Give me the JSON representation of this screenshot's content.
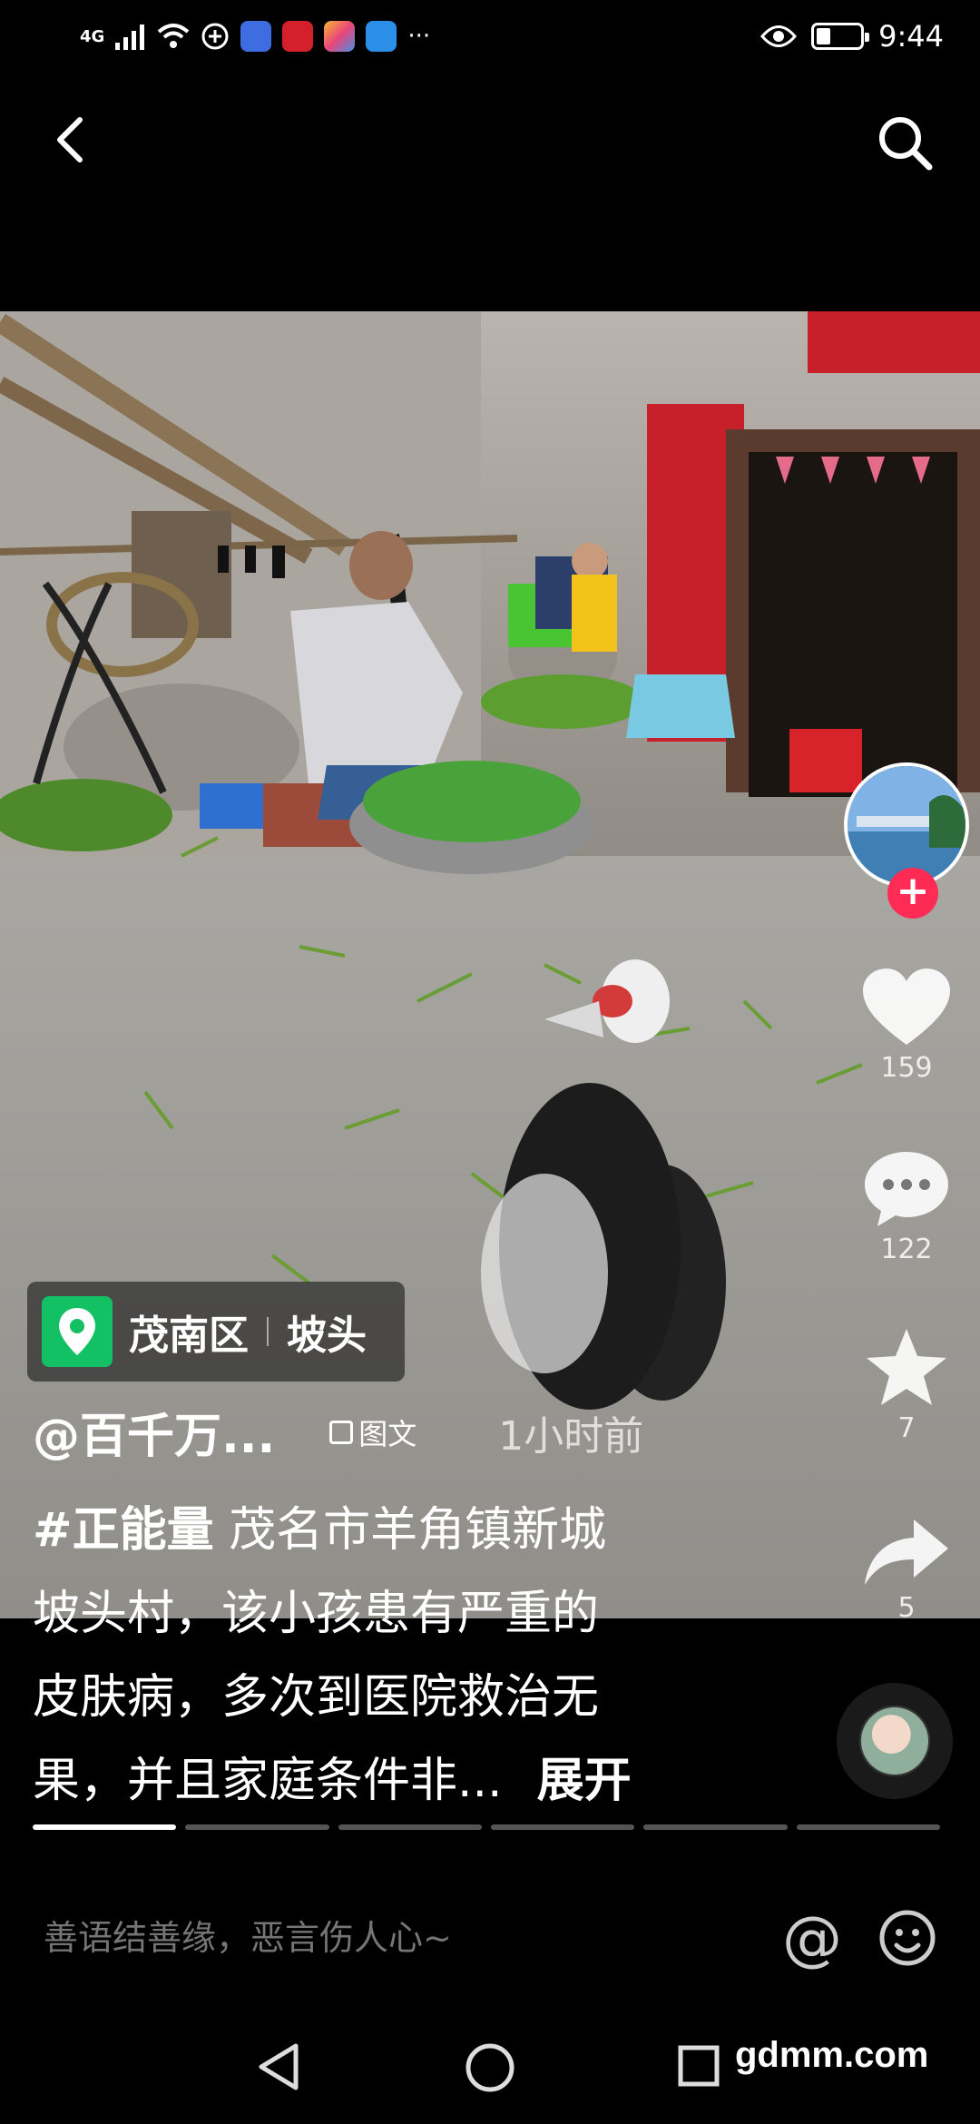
{
  "status_bar": {
    "network": "4G",
    "time": "9:44",
    "more": "···",
    "battery_level": 0.3,
    "icons": [
      "signal-icon",
      "wifi-icon",
      "vpn-icon",
      "music-app-icon",
      "news-app-icon",
      "store-app-icon",
      "weather-app-icon",
      "eye-icon",
      "battery-icon"
    ]
  },
  "header": {
    "back_icon": "back-arrow-icon",
    "search_icon": "search-icon"
  },
  "location": {
    "district": "茂南区",
    "place": "坡头"
  },
  "author": {
    "name": "@百千万...",
    "post_type": "图文",
    "time": "1小时前"
  },
  "caption": {
    "tag": "#正能量",
    "text_line1": " 茂名市羊角镇新城",
    "text_line2": "坡头村，该小孩患有严重的",
    "text_line3": "皮肤病，多次到医院救治无",
    "text_line4": "果，并且家庭条件非...",
    "expand_label": "展开"
  },
  "actions": {
    "like_count": "159",
    "comment_count": "122",
    "favorite_count": "7",
    "share_count": "5"
  },
  "progress": {
    "segments": 6,
    "active_index": 0
  },
  "comment_bar": {
    "placeholder": "善语结善缘，恶言伤人心~",
    "at_label": "@"
  },
  "watermark": "gdmm.com",
  "colors": {
    "follow": "#fe2c55",
    "location_icon": "#13c063",
    "background": "#000000"
  }
}
